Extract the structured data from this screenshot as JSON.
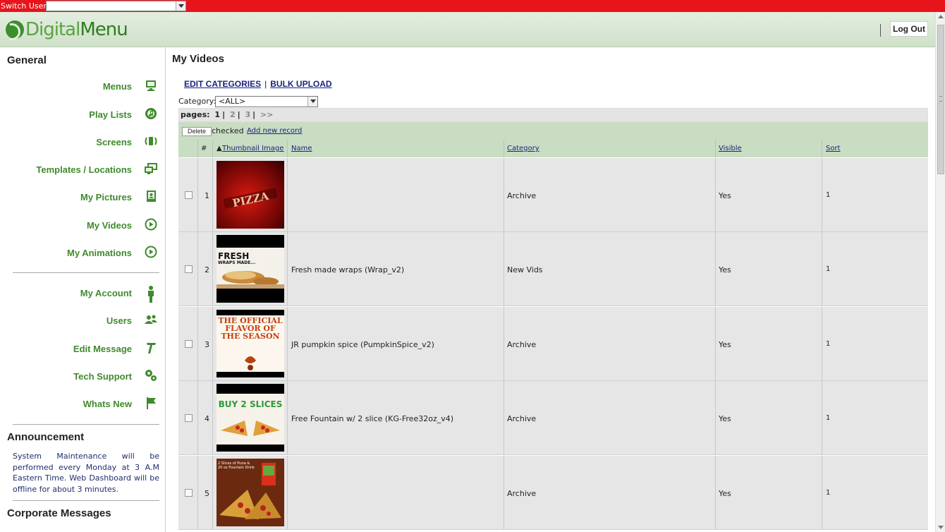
{
  "topbar": {
    "switch_user_label": "Switch User:",
    "switch_user_value": ""
  },
  "header": {
    "logo_part1": "Digital",
    "logo_part2": "Menu",
    "logout_label": "Log Out"
  },
  "sidebar": {
    "general_heading": "General",
    "items": [
      {
        "label": "Menus",
        "icon": "monitor-icon"
      },
      {
        "label": "Play Lists",
        "icon": "music-disc-icon"
      },
      {
        "label": "Screens",
        "icon": "screen-broadcast-icon"
      },
      {
        "label": "Templates / Locations",
        "icon": "dual-monitor-icon"
      },
      {
        "label": "My Pictures",
        "icon": "picture-icon"
      },
      {
        "label": "My Videos",
        "icon": "play-circle-icon"
      },
      {
        "label": "My Animations",
        "icon": "play-circle-icon"
      }
    ],
    "items2": [
      {
        "label": "My Account",
        "icon": "person-icon"
      },
      {
        "label": "Users",
        "icon": "users-icon"
      },
      {
        "label": "Edit Message",
        "icon": "text-tool-icon"
      },
      {
        "label": "Tech Support",
        "icon": "gears-icon"
      },
      {
        "label": "Whats New",
        "icon": "flag-icon"
      }
    ],
    "announcement_heading": "Announcement",
    "announcement_text": "System Maintenance will be performed every Monday at 3 A.M Eastern Time. Web Dashboard will be offline for about 3 minutes.",
    "corporate_heading": "Corporate Messages"
  },
  "main": {
    "title": "My Videos",
    "edit_categories": "EDIT CATEGORIES",
    "link_sep": "|",
    "bulk_upload": "BULK UPLOAD",
    "category_label": "Category:",
    "category_value": "<ALL>",
    "pages_label": "pages:",
    "pages": [
      "1",
      "2",
      "3"
    ],
    "pages_next": ">>",
    "pages_sep": "|",
    "delete_label": "Delete",
    "checked_label": "checked",
    "add_new_label": "Add new record",
    "columns": {
      "num": "#",
      "sort_arrow": "▲",
      "thumbnail": "Thumbnail Image",
      "name": "Name",
      "category": "Category",
      "visible": "Visible",
      "sort": "Sort"
    },
    "thumb_texts": {
      "t1": "PIZZA",
      "t2a": "FRESH",
      "t2b": "WRAPS MADE...",
      "t3": "THE OFFICIAL FLAVOR OF THE SEASON",
      "t4": "BUY 2 SLICES",
      "t5": "2 Slices of Pizza & 20 oz Fountain Drink"
    },
    "rows": [
      {
        "num": "1",
        "name": "",
        "category": "Archive",
        "visible": "Yes",
        "sort": "1"
      },
      {
        "num": "2",
        "name": "Fresh made wraps (Wrap_v2)",
        "category": "New Vids",
        "visible": "Yes",
        "sort": "1"
      },
      {
        "num": "3",
        "name": "JR pumpkin spice (PumpkinSpice_v2)",
        "category": "Archive",
        "visible": "Yes",
        "sort": "1"
      },
      {
        "num": "4",
        "name": "Free Fountain w/ 2 slice (KG-Free32oz_v4)",
        "category": "Archive",
        "visible": "Yes",
        "sort": "1"
      },
      {
        "num": "5",
        "name": "",
        "category": "Archive",
        "visible": "Yes",
        "sort": "1"
      }
    ]
  }
}
